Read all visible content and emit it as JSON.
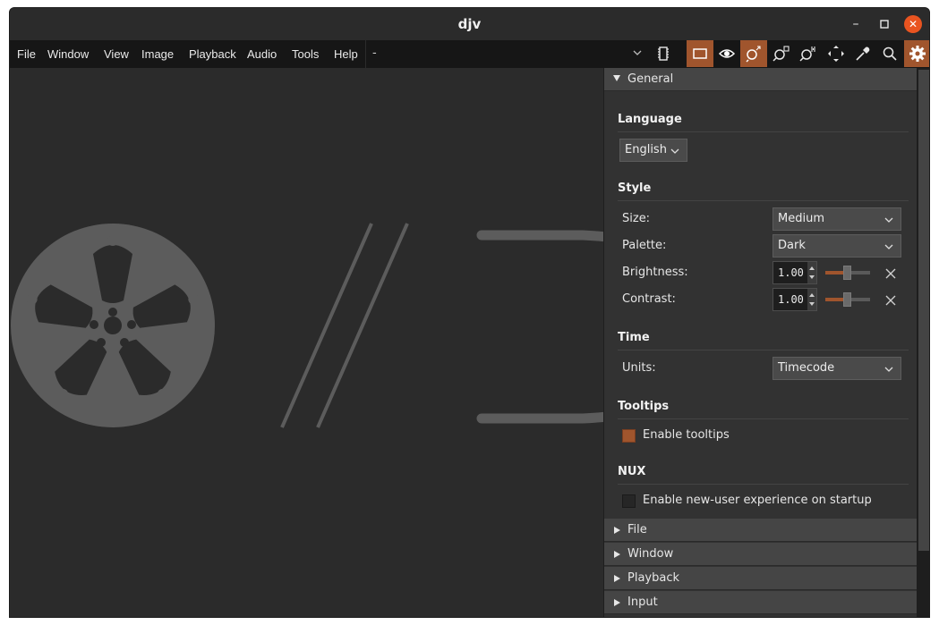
{
  "window": {
    "title": "djv"
  },
  "window_controls": {
    "minimize": "–",
    "maximize": "◻",
    "close": "✕"
  },
  "menu": [
    "File",
    "Window",
    "View",
    "Image",
    "Playback",
    "Audio",
    "Tools",
    "Help"
  ],
  "file_selector": {
    "value": "-"
  },
  "toolbar_icons": [
    "memory-icon",
    "frame-icon",
    "eye-icon",
    "zoom-fit-icon",
    "zoom-reset-icon",
    "zoom-one-icon",
    "move-icon",
    "color-picker-icon",
    "magnify-icon",
    "settings-icon"
  ],
  "accent_color": "#a0552d",
  "settings": {
    "general_header": "General",
    "language": {
      "title": "Language",
      "value": "English"
    },
    "style": {
      "title": "Style",
      "size_label": "Size:",
      "size_value": "Medium",
      "palette_label": "Palette:",
      "palette_value": "Dark",
      "brightness_label": "Brightness:",
      "brightness_value": "1.00",
      "contrast_label": "Contrast:",
      "contrast_value": "1.00"
    },
    "time": {
      "title": "Time",
      "units_label": "Units:",
      "units_value": "Timecode"
    },
    "tooltips": {
      "title": "Tooltips",
      "enable_label": "Enable tooltips",
      "enabled": true
    },
    "nux": {
      "title": "NUX",
      "enable_label": "Enable new-user experience on startup",
      "enabled": false
    },
    "collapsed_sections": [
      "File",
      "Window",
      "Playback",
      "Input"
    ]
  }
}
